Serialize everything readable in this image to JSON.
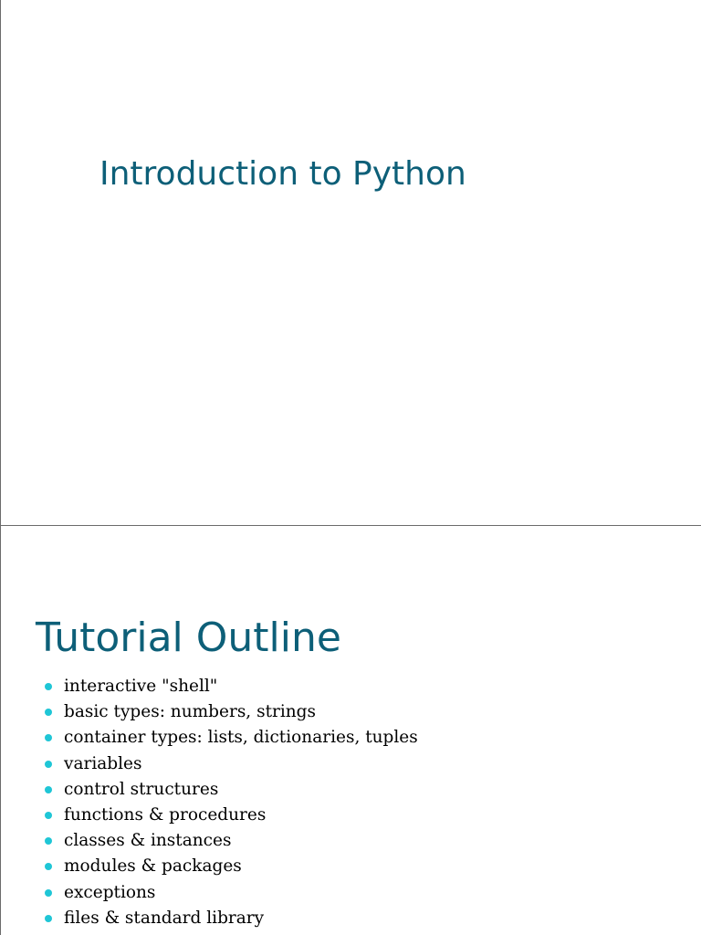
{
  "slides": [
    {
      "title": "Introduction to Python"
    },
    {
      "title": "Tutorial Outline",
      "bullets": [
        "interactive \"shell\"",
        "basic types: numbers, strings",
        "container types: lists, dictionaries, tuples",
        "variables",
        "control structures",
        "functions & procedures",
        "classes & instances",
        "modules & packages",
        "exceptions",
        "files & standard library"
      ]
    }
  ],
  "colors": {
    "title": "#0d5f78",
    "bullet_marker": "#1fc6d6",
    "body_text": "#000000",
    "slide_border": "#6b6b6b"
  },
  "icons": {
    "bullet": "filled-circle"
  }
}
